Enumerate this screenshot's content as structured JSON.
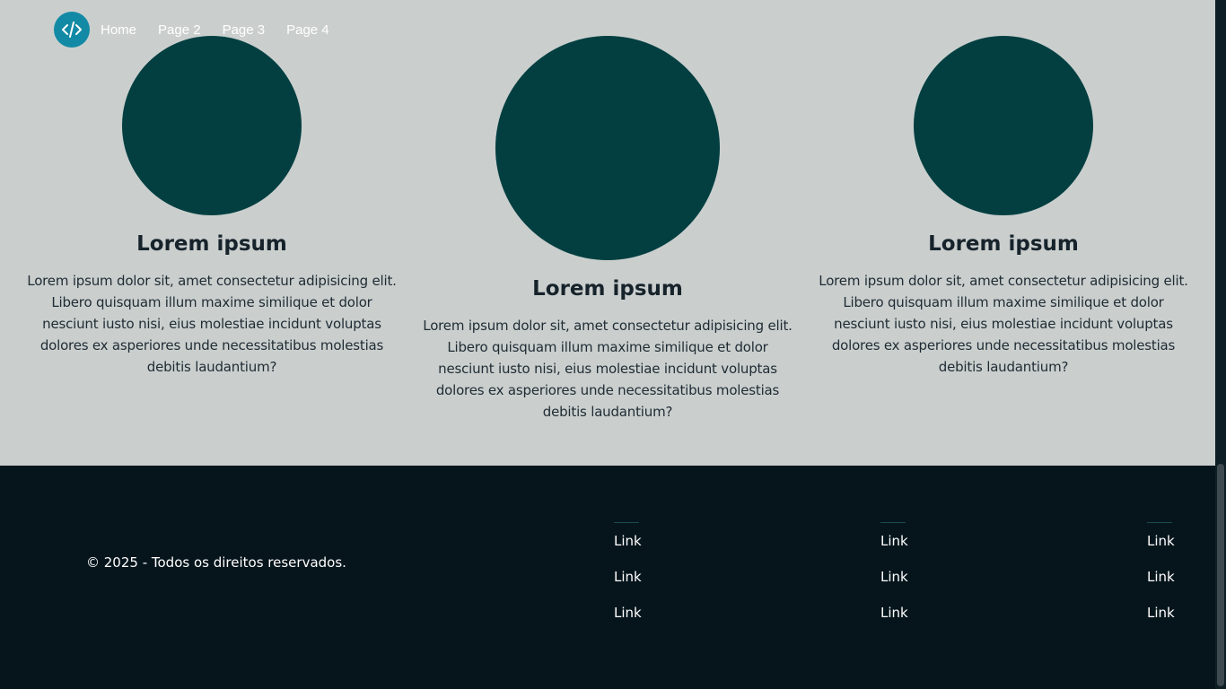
{
  "nav": {
    "logo_icon": "code-icon",
    "items": [
      {
        "label": "Home"
      },
      {
        "label": "Page 2"
      },
      {
        "label": "Page 3"
      },
      {
        "label": "Page 4"
      }
    ]
  },
  "cards": [
    {
      "title": "Lorem ipsum",
      "text": "Lorem ipsum dolor sit, amet consectetur adipisicing elit. Libero quisquam illum maxime similique et dolor nesciunt iusto nisi, eius molestiae incidunt voluptas dolores ex asperiores unde necessitatibus molestias debitis laudantium?"
    },
    {
      "title": "Lorem ipsum",
      "text": "Lorem ipsum dolor sit, amet consectetur adipisicing elit. Libero quisquam illum maxime similique et dolor nesciunt iusto nisi, eius molestiae incidunt voluptas dolores ex asperiores unde necessitatibus molestias debitis laudantium?"
    },
    {
      "title": "Lorem ipsum",
      "text": "Lorem ipsum dolor sit, amet consectetur adipisicing elit. Libero quisquam illum maxime similique et dolor nesciunt iusto nisi, eius molestiae incidunt voluptas dolores ex asperiores unde necessitatibus molestias debitis laudantium?"
    }
  ],
  "footer": {
    "copyright": "© 2025 - Todos os direitos reservados.",
    "columns": [
      {
        "links": [
          "Link",
          "Link",
          "Link"
        ]
      },
      {
        "links": [
          "Link",
          "Link",
          "Link"
        ]
      },
      {
        "links": [
          "Link",
          "Link",
          "Link"
        ]
      }
    ]
  },
  "colors": {
    "background": "#cacfce",
    "circle": "#033f41",
    "footer": "#06151c",
    "logo": "#128aa5"
  }
}
